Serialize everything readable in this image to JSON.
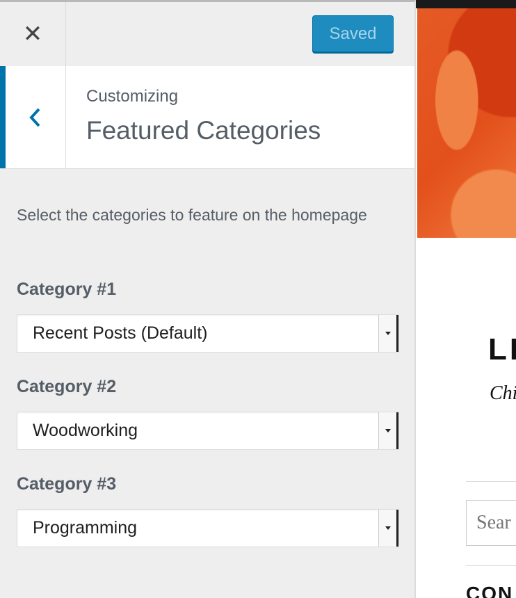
{
  "topbar": {
    "close_icon": "close-icon",
    "save_label": "Saved"
  },
  "section": {
    "back_icon": "chevron-left-icon",
    "breadcrumb": "Customizing",
    "title": "Featured Categories",
    "description": "Select the categories to feature on the homepage"
  },
  "fields": [
    {
      "label": "Category #1",
      "value": "Recent Posts (Default)"
    },
    {
      "label": "Category #2",
      "value": "Woodworking"
    },
    {
      "label": "Category #3",
      "value": "Programming"
    }
  ],
  "preview": {
    "site_title": "LE",
    "tagline": "Chi",
    "search_placeholder": "Sear",
    "section_heading": "CON"
  },
  "colors": {
    "accent": "#0073aa",
    "saved_button": "#1e8cbe",
    "panel_bg": "#eeeeee",
    "hero": "#e3501b"
  }
}
